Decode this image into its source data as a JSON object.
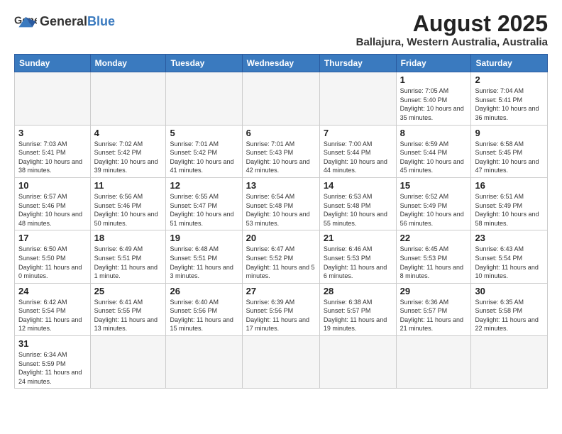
{
  "header": {
    "logo_general": "General",
    "logo_blue": "Blue",
    "title": "August 2025",
    "subtitle": "Ballajura, Western Australia, Australia"
  },
  "weekdays": [
    "Sunday",
    "Monday",
    "Tuesday",
    "Wednesday",
    "Thursday",
    "Friday",
    "Saturday"
  ],
  "weeks": [
    [
      {
        "day": "",
        "info": ""
      },
      {
        "day": "",
        "info": ""
      },
      {
        "day": "",
        "info": ""
      },
      {
        "day": "",
        "info": ""
      },
      {
        "day": "",
        "info": ""
      },
      {
        "day": "1",
        "info": "Sunrise: 7:05 AM\nSunset: 5:40 PM\nDaylight: 10 hours and 35 minutes."
      },
      {
        "day": "2",
        "info": "Sunrise: 7:04 AM\nSunset: 5:41 PM\nDaylight: 10 hours and 36 minutes."
      }
    ],
    [
      {
        "day": "3",
        "info": "Sunrise: 7:03 AM\nSunset: 5:41 PM\nDaylight: 10 hours and 38 minutes."
      },
      {
        "day": "4",
        "info": "Sunrise: 7:02 AM\nSunset: 5:42 PM\nDaylight: 10 hours and 39 minutes."
      },
      {
        "day": "5",
        "info": "Sunrise: 7:01 AM\nSunset: 5:42 PM\nDaylight: 10 hours and 41 minutes."
      },
      {
        "day": "6",
        "info": "Sunrise: 7:01 AM\nSunset: 5:43 PM\nDaylight: 10 hours and 42 minutes."
      },
      {
        "day": "7",
        "info": "Sunrise: 7:00 AM\nSunset: 5:44 PM\nDaylight: 10 hours and 44 minutes."
      },
      {
        "day": "8",
        "info": "Sunrise: 6:59 AM\nSunset: 5:44 PM\nDaylight: 10 hours and 45 minutes."
      },
      {
        "day": "9",
        "info": "Sunrise: 6:58 AM\nSunset: 5:45 PM\nDaylight: 10 hours and 47 minutes."
      }
    ],
    [
      {
        "day": "10",
        "info": "Sunrise: 6:57 AM\nSunset: 5:46 PM\nDaylight: 10 hours and 48 minutes."
      },
      {
        "day": "11",
        "info": "Sunrise: 6:56 AM\nSunset: 5:46 PM\nDaylight: 10 hours and 50 minutes."
      },
      {
        "day": "12",
        "info": "Sunrise: 6:55 AM\nSunset: 5:47 PM\nDaylight: 10 hours and 51 minutes."
      },
      {
        "day": "13",
        "info": "Sunrise: 6:54 AM\nSunset: 5:48 PM\nDaylight: 10 hours and 53 minutes."
      },
      {
        "day": "14",
        "info": "Sunrise: 6:53 AM\nSunset: 5:48 PM\nDaylight: 10 hours and 55 minutes."
      },
      {
        "day": "15",
        "info": "Sunrise: 6:52 AM\nSunset: 5:49 PM\nDaylight: 10 hours and 56 minutes."
      },
      {
        "day": "16",
        "info": "Sunrise: 6:51 AM\nSunset: 5:49 PM\nDaylight: 10 hours and 58 minutes."
      }
    ],
    [
      {
        "day": "17",
        "info": "Sunrise: 6:50 AM\nSunset: 5:50 PM\nDaylight: 11 hours and 0 minutes."
      },
      {
        "day": "18",
        "info": "Sunrise: 6:49 AM\nSunset: 5:51 PM\nDaylight: 11 hours and 1 minute."
      },
      {
        "day": "19",
        "info": "Sunrise: 6:48 AM\nSunset: 5:51 PM\nDaylight: 11 hours and 3 minutes."
      },
      {
        "day": "20",
        "info": "Sunrise: 6:47 AM\nSunset: 5:52 PM\nDaylight: 11 hours and 5 minutes."
      },
      {
        "day": "21",
        "info": "Sunrise: 6:46 AM\nSunset: 5:53 PM\nDaylight: 11 hours and 6 minutes."
      },
      {
        "day": "22",
        "info": "Sunrise: 6:45 AM\nSunset: 5:53 PM\nDaylight: 11 hours and 8 minutes."
      },
      {
        "day": "23",
        "info": "Sunrise: 6:43 AM\nSunset: 5:54 PM\nDaylight: 11 hours and 10 minutes."
      }
    ],
    [
      {
        "day": "24",
        "info": "Sunrise: 6:42 AM\nSunset: 5:54 PM\nDaylight: 11 hours and 12 minutes."
      },
      {
        "day": "25",
        "info": "Sunrise: 6:41 AM\nSunset: 5:55 PM\nDaylight: 11 hours and 13 minutes."
      },
      {
        "day": "26",
        "info": "Sunrise: 6:40 AM\nSunset: 5:56 PM\nDaylight: 11 hours and 15 minutes."
      },
      {
        "day": "27",
        "info": "Sunrise: 6:39 AM\nSunset: 5:56 PM\nDaylight: 11 hours and 17 minutes."
      },
      {
        "day": "28",
        "info": "Sunrise: 6:38 AM\nSunset: 5:57 PM\nDaylight: 11 hours and 19 minutes."
      },
      {
        "day": "29",
        "info": "Sunrise: 6:36 AM\nSunset: 5:57 PM\nDaylight: 11 hours and 21 minutes."
      },
      {
        "day": "30",
        "info": "Sunrise: 6:35 AM\nSunset: 5:58 PM\nDaylight: 11 hours and 22 minutes."
      }
    ],
    [
      {
        "day": "31",
        "info": "Sunrise: 6:34 AM\nSunset: 5:59 PM\nDaylight: 11 hours and 24 minutes."
      },
      {
        "day": "",
        "info": ""
      },
      {
        "day": "",
        "info": ""
      },
      {
        "day": "",
        "info": ""
      },
      {
        "day": "",
        "info": ""
      },
      {
        "day": "",
        "info": ""
      },
      {
        "day": "",
        "info": ""
      }
    ]
  ]
}
